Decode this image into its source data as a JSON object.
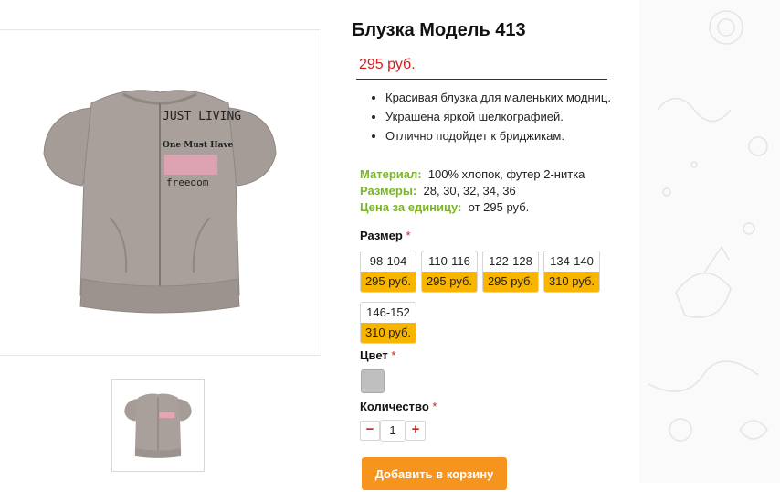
{
  "product": {
    "title": "Блузка Модель 413",
    "price": "295 руб."
  },
  "features": [
    "Красивая блузка для маленьких модниц.",
    "Украшена яркой шелкографией.",
    "Отлично подойдет к бриджикам."
  ],
  "specs": {
    "material_label": "Материал:",
    "material_value": "100% хлопок, футер 2-нитка",
    "sizes_label": "Размеры:",
    "sizes_value": "28, 30, 32, 34, 36",
    "unit_price_label": "Цена за единицу:",
    "unit_price_value": "от 295 руб."
  },
  "size_section": {
    "label": "Размер",
    "required_mark": "*",
    "options": [
      {
        "size": "98-104",
        "price": "295 руб."
      },
      {
        "size": "110-116",
        "price": "295 руб."
      },
      {
        "size": "122-128",
        "price": "295 руб."
      },
      {
        "size": "134-140",
        "price": "310 руб."
      },
      {
        "size": "146-152",
        "price": "310 руб."
      }
    ]
  },
  "color_section": {
    "label": "Цвет",
    "required_mark": "*",
    "swatch_color": "#bfbfbf"
  },
  "quantity_section": {
    "label": "Количество",
    "required_mark": "*",
    "minus": "−",
    "value": "1",
    "plus": "+"
  },
  "cart_button": "Добавить в корзину",
  "shirt_print": {
    "line1": "JUST LIVING",
    "line2": "One Must Have",
    "line3": "freedom"
  },
  "colors": {
    "price_red": "#d21e1e",
    "spec_green": "#7ab526",
    "size_price_yellow": "#f7b500",
    "cart_orange": "#f7941d",
    "garment_grey": "#a59c97"
  }
}
